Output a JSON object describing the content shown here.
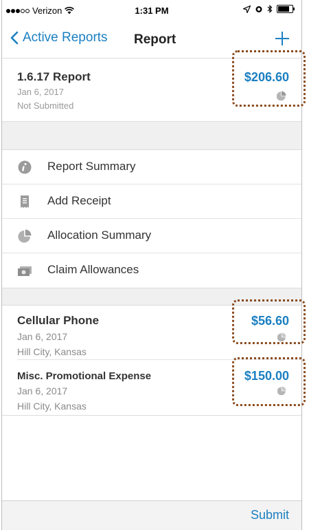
{
  "status_bar": {
    "carrier": "Verizon",
    "time": "1:31 PM"
  },
  "nav": {
    "back_label": "Active Reports",
    "title": "Report"
  },
  "report": {
    "title": "1.6.17 Report",
    "date": "Jan 6, 2017",
    "status": "Not Submitted",
    "amount": "$206.60"
  },
  "menu": {
    "items": [
      {
        "label": "Report Summary",
        "icon": "info-icon"
      },
      {
        "label": "Add Receipt",
        "icon": "receipt-icon"
      },
      {
        "label": "Allocation Summary",
        "icon": "pie-chart-icon"
      },
      {
        "label": "Claim Allowances",
        "icon": "cash-icon"
      }
    ]
  },
  "expenses": [
    {
      "title": "Cellular Phone",
      "date": "Jan 6, 2017",
      "location": "Hill City, Kansas",
      "amount": "$56.60"
    },
    {
      "title": "Misc. Promotional Expense",
      "date": "Jan 6, 2017",
      "location": "Hill City, Kansas",
      "amount": "$150.00"
    }
  ],
  "toolbar": {
    "submit_label": "Submit"
  },
  "colors": {
    "accent": "#1a7fc1",
    "annotation": "#8a4a1c"
  }
}
